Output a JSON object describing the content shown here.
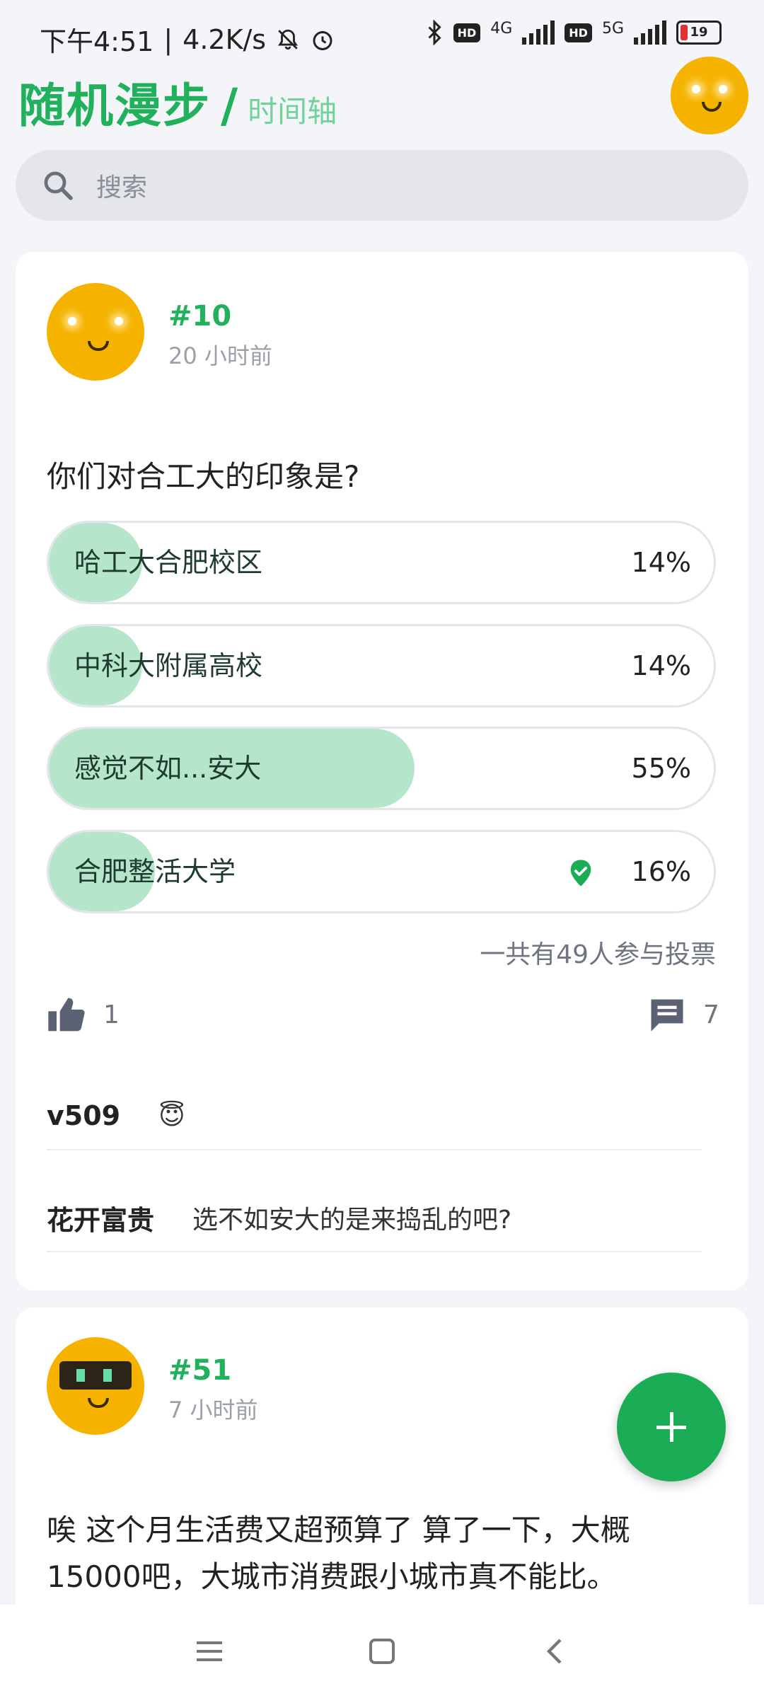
{
  "status": {
    "time": "下午4:51",
    "speed": "4.2K/s",
    "net1": "4G",
    "net2": "5G",
    "battery": "19"
  },
  "header": {
    "title": "随机漫步",
    "separator": "/",
    "subtitle": "时间轴"
  },
  "search": {
    "placeholder": "搜索"
  },
  "post1": {
    "number": "#10",
    "time": "20 小时前",
    "question": "你们对合工大的印象是?",
    "options": [
      {
        "label": "哈工大合肥校区",
        "percent": "14%",
        "value": 0.14,
        "voted": false
      },
      {
        "label": "中科大附属高校",
        "percent": "14%",
        "value": 0.14,
        "voted": false
      },
      {
        "label": "感觉不如...安大",
        "percent": "55%",
        "value": 0.55,
        "voted": false
      },
      {
        "label": "合肥整活大学",
        "percent": "16%",
        "value": 0.16,
        "voted": true
      }
    ],
    "total": "一共有49人参与投票",
    "likes": "1",
    "comments_count": "7",
    "comments": [
      {
        "author": "v509",
        "text": "😇"
      },
      {
        "author": "花开富贵",
        "text": "选不如安大的是来捣乱的吧?"
      }
    ]
  },
  "post2": {
    "number": "#51",
    "time": "7 小时前",
    "body": "唉 这个月生活费又超预算了 算了一下，大概15000吧，大城市消费跟小城市真不能比。"
  },
  "colors": {
    "accent": "#21b05b",
    "poll_fill": "#b5e6cc",
    "avatar": "#f5b300"
  },
  "icons": [
    "bell-off-icon",
    "alarm-icon",
    "bluetooth-icon",
    "search-icon",
    "thumbs-up-icon",
    "comment-icon",
    "check-shield-icon",
    "plus-icon",
    "menu-icon",
    "home-icon",
    "back-icon"
  ]
}
